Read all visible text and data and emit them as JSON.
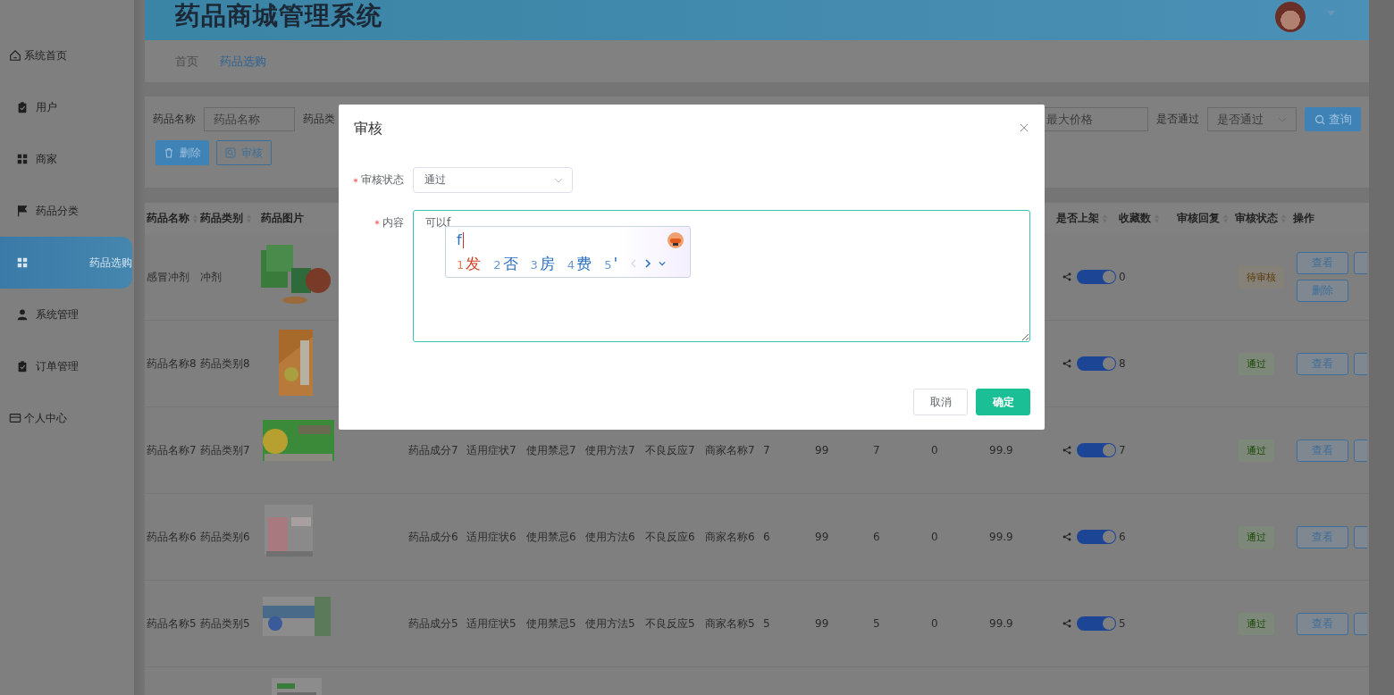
{
  "sidebar": {
    "items": [
      {
        "label": "系统首页",
        "kind": "home",
        "selected": false
      },
      {
        "label": "用户",
        "kind": "clipboard",
        "selected": false
      },
      {
        "label": "商家",
        "kind": "grid",
        "selected": false
      },
      {
        "label": "药品分类",
        "kind": "flag",
        "selected": false
      },
      {
        "label": "药品选购",
        "kind": "grid",
        "selected": true
      },
      {
        "label": "系统管理",
        "kind": "person",
        "selected": false
      },
      {
        "label": "订单管理",
        "kind": "clipboard",
        "selected": false
      },
      {
        "label": "个人中心",
        "kind": "card",
        "selected": false
      }
    ]
  },
  "header": {
    "title": "药品商城管理系统"
  },
  "breadcrumb": [
    {
      "label": "首页",
      "selected": false
    },
    {
      "label": "药品选购",
      "selected": true
    }
  ],
  "search": {
    "name_label": "药品名称",
    "name_placeholder": "药品名称",
    "category_label": "药品类",
    "max_price_placeholder": "最大价格",
    "pass_label": "是否通过",
    "pass_placeholder": "是否通过",
    "query_button": "查询"
  },
  "toolbar": [
    {
      "label": "删除",
      "kind": "delete"
    },
    {
      "label": "审核",
      "kind": "review"
    }
  ],
  "table": {
    "columns_left": [
      {
        "label": "药品名称",
        "sortable": true
      },
      {
        "label": "药品类别",
        "sortable": true
      },
      {
        "label": "药品图片",
        "sortable": false
      }
    ],
    "columns_right": [
      {
        "label": "是否上架",
        "sortable": true
      },
      {
        "label": "收藏数",
        "sortable": true
      },
      {
        "label": "审核回复",
        "sortable": true
      },
      {
        "label": "审核状态",
        "sortable": true
      },
      {
        "label": "操作",
        "sortable": false
      }
    ],
    "rows": [
      {
        "name": "感冒冲剂",
        "category": "冲剂",
        "details": [],
        "on": true,
        "favorites": "0",
        "status": {
          "label": "待审核",
          "kind": "pending"
        },
        "actions": [
          "查看",
          "删除"
        ]
      },
      {
        "name": "药品名称8",
        "category": "药品类别8",
        "details": [],
        "on": true,
        "favorites": "8",
        "status": {
          "label": "通过",
          "kind": "passed"
        },
        "actions": [
          "查看"
        ]
      },
      {
        "name": "药品名称7",
        "category": "药品类别7",
        "details": [
          "药品成分7",
          "适用症状7",
          "使用禁忌7",
          "使用方法7",
          "不良反应7",
          "商家名称7",
          "7",
          "99",
          "7",
          "0",
          "99.9"
        ],
        "on": true,
        "favorites": "7",
        "status": {
          "label": "通过",
          "kind": "passed"
        },
        "actions": [
          "查看"
        ]
      },
      {
        "name": "药品名称6",
        "category": "药品类别6",
        "details": [
          "药品成分6",
          "适用症状6",
          "使用禁忌6",
          "使用方法6",
          "不良反应6",
          "商家名称6",
          "6",
          "99",
          "6",
          "0",
          "99.9"
        ],
        "on": true,
        "favorites": "6",
        "status": {
          "label": "通过",
          "kind": "passed"
        },
        "actions": [
          "查看"
        ]
      },
      {
        "name": "药品名称5",
        "category": "药品类别5",
        "details": [
          "药品成分5",
          "适用症状5",
          "使用禁忌5",
          "使用方法5",
          "不良反应5",
          "商家名称5",
          "5",
          "99",
          "5",
          "0",
          "99.9"
        ],
        "on": true,
        "favorites": "5",
        "status": {
          "label": "通过",
          "kind": "passed"
        },
        "actions": [
          "查看"
        ]
      },
      {}
    ]
  },
  "modal": {
    "title": "审核",
    "fields": [
      {
        "label": "审核状态",
        "required": true,
        "kind": "select",
        "value": "通过"
      },
      {
        "label": "内容",
        "required": true,
        "kind": "textarea",
        "value": "可以f"
      }
    ],
    "ime": {
      "composition": "f",
      "candidates": [
        {
          "index": "1",
          "text": "发",
          "selected": true
        },
        {
          "index": "2",
          "text": "否",
          "selected": false
        },
        {
          "index": "3",
          "text": "房",
          "selected": false
        },
        {
          "index": "4",
          "text": "费",
          "selected": false
        },
        {
          "index": "5",
          "text": "'",
          "selected": false
        }
      ]
    },
    "buttons": [
      {
        "label": "取消",
        "kind": "plain"
      },
      {
        "label": "确定",
        "kind": "primary"
      }
    ]
  }
}
